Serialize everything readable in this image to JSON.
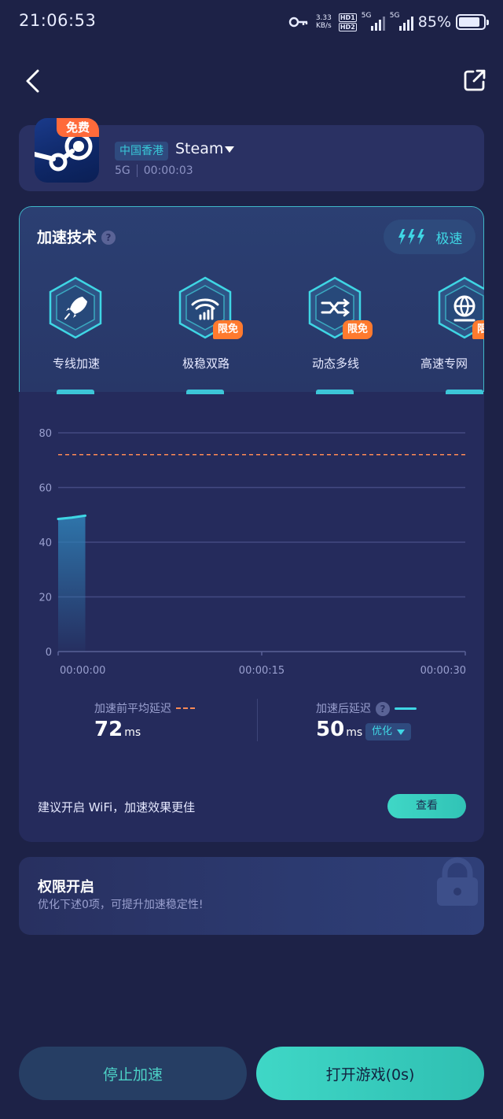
{
  "status_bar": {
    "time": "21:06:53",
    "net_speed_value": "3.33",
    "net_speed_unit": "KB/s",
    "hd1": "HD1",
    "hd2": "HD2",
    "sim1": "5G",
    "sim2": "5G",
    "battery": "85%",
    "battery_level": 0.85
  },
  "game": {
    "badge": "免费",
    "region": "中国香港",
    "name": "Steam",
    "network": "5G",
    "duration": "00:00:03"
  },
  "accel": {
    "title": "加速技术",
    "help": "?",
    "mode": "极速",
    "techs": [
      {
        "label": "专线加速",
        "icon": "rocket-icon",
        "badge": ""
      },
      {
        "label": "极稳双路",
        "icon": "wifi-dual-icon",
        "badge": "限免"
      },
      {
        "label": "动态多线",
        "icon": "multi-line-icon",
        "badge": "限免"
      },
      {
        "label": "高速专网",
        "icon": "globe-icon",
        "badge": "限免"
      }
    ]
  },
  "chart_data": {
    "type": "area",
    "y_ticks": [
      "80",
      "60",
      "40",
      "20",
      "0"
    ],
    "x_ticks": [
      "00:00:00",
      "00:00:15",
      "00:00:30"
    ],
    "ylim": [
      0,
      80
    ],
    "xlim": [
      0,
      30
    ],
    "avg_before": 72,
    "series": [
      {
        "x": [
          0,
          1,
          2
        ],
        "y": [
          48.5,
          49,
          49.7
        ]
      }
    ],
    "colors": {
      "before": "#ff8a55",
      "after": "#3fd6e4"
    }
  },
  "stats": {
    "before_label": "加速前平均延迟",
    "before_value": "72",
    "before_unit": "ms",
    "after_label": "加速后延迟",
    "after_value": "50",
    "after_unit": "ms",
    "after_tag": "优化"
  },
  "tip": {
    "text": "建议开启 WiFi，加速效果更佳",
    "button": "查看"
  },
  "permission": {
    "title": "权限开启",
    "desc": "优化下述0项，可提升加速稳定性!"
  },
  "actions": {
    "stop": "停止加速",
    "open": "打开游戏(0s)"
  }
}
